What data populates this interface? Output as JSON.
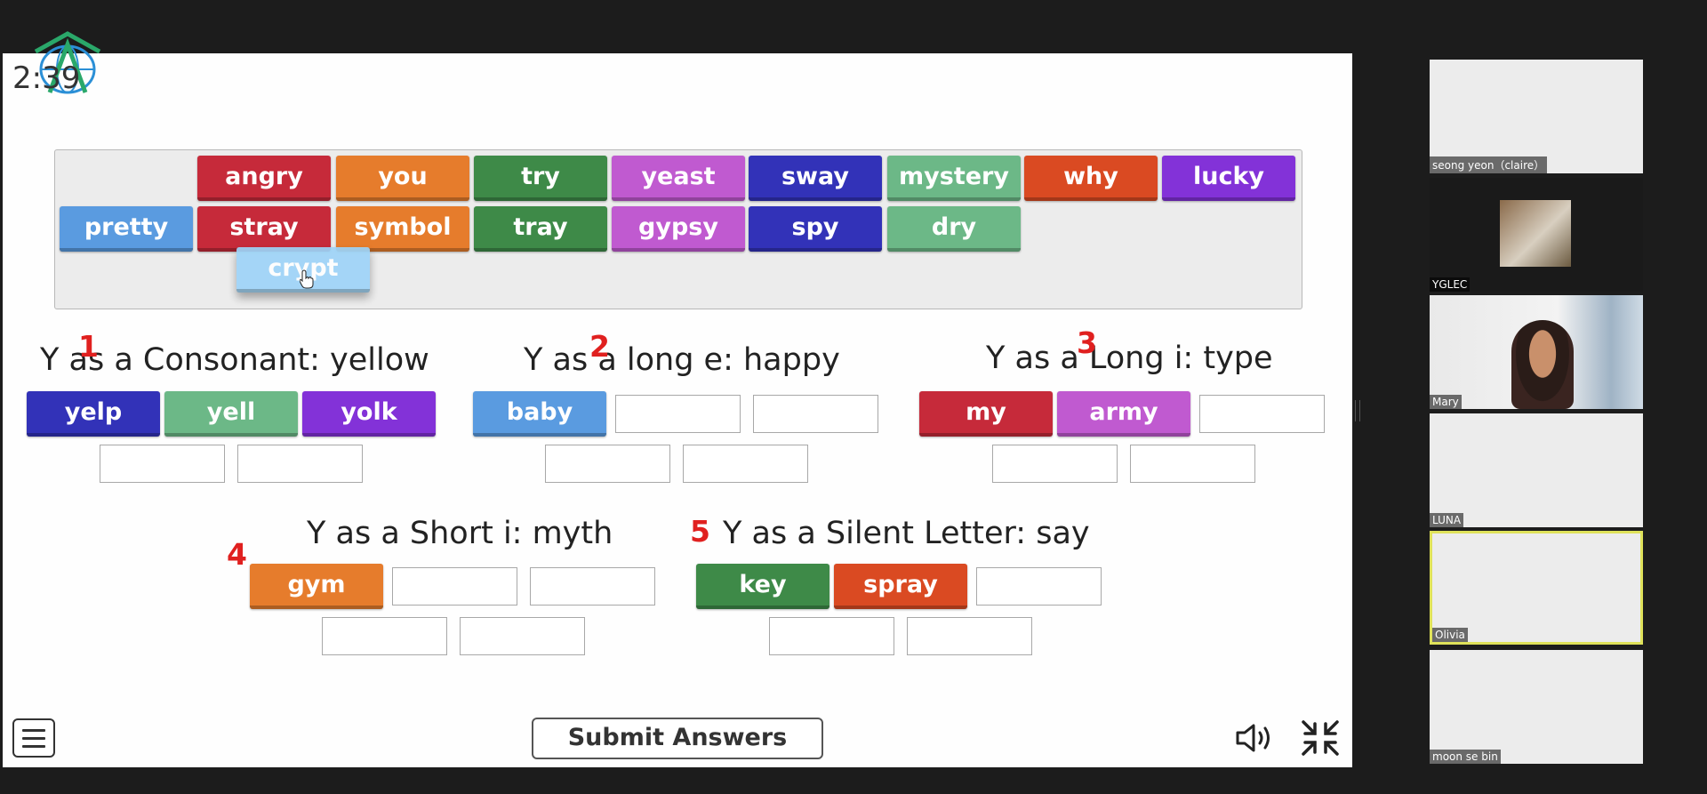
{
  "game": {
    "timer": "2:39",
    "bank_words": [
      {
        "label": "angry",
        "color": "#c62a3a"
      },
      {
        "label": "you",
        "color": "#e67c2c"
      },
      {
        "label": "try",
        "color": "#3e8a48"
      },
      {
        "label": "yeast",
        "color": "#c05ad0"
      },
      {
        "label": "sway",
        "color": "#3232b8"
      },
      {
        "label": "mystery",
        "color": "#6cb887"
      },
      {
        "label": "why",
        "color": "#da4a22"
      },
      {
        "label": "lucky",
        "color": "#8332d8"
      },
      {
        "label": "pretty",
        "color": "#5a9be0"
      },
      {
        "label": "stray",
        "color": "#c62a3a"
      },
      {
        "label": "symbol",
        "color": "#e67c2c"
      },
      {
        "label": "tray",
        "color": "#3e8a48"
      },
      {
        "label": "gypsy",
        "color": "#c05ad0"
      },
      {
        "label": "spy",
        "color": "#3232b8"
      },
      {
        "label": "dry",
        "color": "#6cb887"
      },
      {
        "label": "crypt",
        "color": "#9ed4f8"
      }
    ],
    "categories": [
      {
        "number": "1",
        "title": "Y as a Consonant: yellow",
        "placed": [
          {
            "label": "yelp",
            "color": "#3232b8"
          },
          {
            "label": "yell",
            "color": "#6cb887"
          },
          {
            "label": "yolk",
            "color": "#8332d8"
          }
        ]
      },
      {
        "number": "2",
        "title": "Y as a long e: happy",
        "placed": [
          {
            "label": "baby",
            "color": "#5a9be0"
          }
        ]
      },
      {
        "number": "3",
        "title": "Y as a Long i: type",
        "placed": [
          {
            "label": "my",
            "color": "#c62a3a"
          },
          {
            "label": "army",
            "color": "#c05ad0"
          }
        ]
      },
      {
        "number": "4",
        "title": "Y as a Short i: myth",
        "placed": [
          {
            "label": "gym",
            "color": "#e67c2c"
          }
        ]
      },
      {
        "number": "5",
        "title": "Y as a Silent Letter: say",
        "placed": [
          {
            "label": "key",
            "color": "#3e8a48"
          },
          {
            "label": "spray",
            "color": "#da4a22"
          }
        ]
      }
    ],
    "submit_label": "Submit Answers"
  },
  "participants": [
    {
      "name": "seong yeon（claire）",
      "video": false,
      "highlight": false
    },
    {
      "name": "YGLEC",
      "video": true,
      "highlight": false
    },
    {
      "name": "Mary",
      "video": true,
      "highlight": false
    },
    {
      "name": "LUNA",
      "video": false,
      "highlight": false
    },
    {
      "name": "Olivia",
      "video": false,
      "highlight": true
    },
    {
      "name": "moon se bin",
      "video": false,
      "highlight": false
    }
  ],
  "icons": {
    "logo": "globe-logo-icon",
    "menu": "hamburger-menu-icon",
    "sound": "speaker-icon",
    "exit_fullscreen": "exit-fullscreen-icon",
    "cursor": "hand-cursor-icon"
  }
}
